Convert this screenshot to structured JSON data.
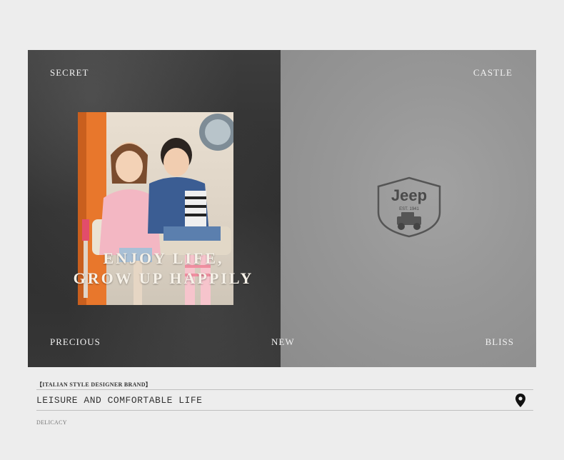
{
  "banner": {
    "top_left_label": "SECRET",
    "top_right_label": "CASTLE",
    "bottom_left_label": "PRECIOUS",
    "bottom_center_label": "NEW",
    "bottom_right_label": "BLISS",
    "headline_line1": "ENJOY LIFE,",
    "headline_line2": "GROW UP HAPPILY",
    "logo": {
      "brand": "Jeep",
      "tagline": "EST. 1941",
      "icon": "jeep-badge-icon"
    }
  },
  "footer": {
    "tag": "【ITALIAN STYLE DESIGNER BRAND】",
    "title": "LEISURE AND COMFORTABLE LIFE",
    "subtitle": "DELICACY",
    "icon": "location-pin-icon"
  },
  "colors": {
    "dark_panel": "#333333",
    "light_panel": "#979797",
    "page_bg": "#ededed"
  }
}
